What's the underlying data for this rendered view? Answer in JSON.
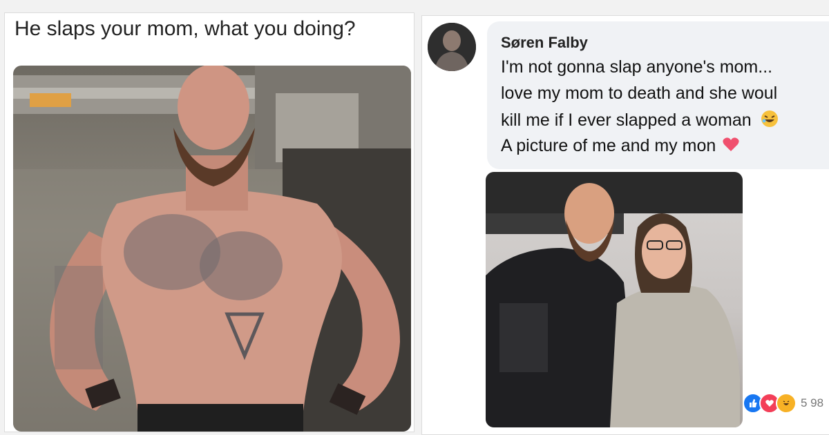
{
  "meme": {
    "caption": "He slaps your mom, what you doing?"
  },
  "comment": {
    "author": "Søren Falby",
    "lines": [
      "I'm not gonna slap anyone's mom...",
      "love my mom to death and she woul",
      "kill me if I ever slapped a woman",
      "A picture of me and my mon"
    ],
    "reaction_count": "5 98"
  },
  "colors": {
    "reaction_like": "#1877f2",
    "reaction_love": "#f33e58",
    "reaction_haha": "#f7b125"
  }
}
